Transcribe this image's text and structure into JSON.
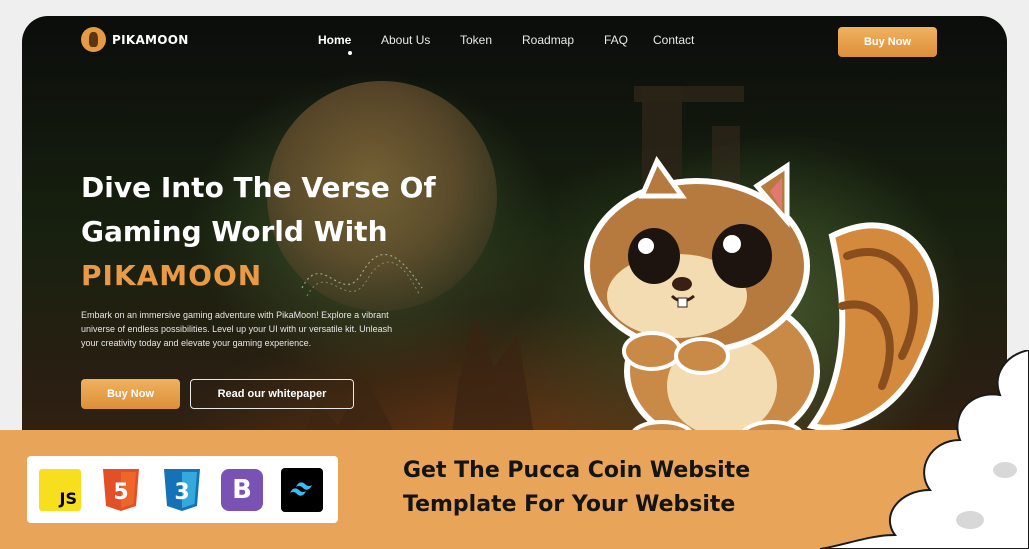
{
  "nav": {
    "logo_text": "PIKAMOON",
    "items": [
      {
        "label": "Home",
        "active": true
      },
      {
        "label": "About Us"
      },
      {
        "label": "Token"
      },
      {
        "label": "Roadmap"
      },
      {
        "label": "FAQ"
      },
      {
        "label": "Contact"
      }
    ],
    "buy_label": "Buy Now"
  },
  "hero": {
    "line1": "Dive Into The Verse Of",
    "line2": "Gaming World With",
    "accent": "PIKAMOON",
    "description": "Embark on an immersive gaming adventure with PikaMoon! Explore a vibrant universe of endless possibilities. Level up your UI with ur versatile kit. Unleash your creativity today and elevate your gaming experience.",
    "primary_label": "Buy Now",
    "secondary_label": "Read our whitepaper"
  },
  "banner": {
    "technologies": [
      {
        "name": "JS",
        "icon": "javascript-icon",
        "color": "#f7df1e"
      },
      {
        "name": "5",
        "icon": "html5-icon",
        "color": "#e34f26"
      },
      {
        "name": "3",
        "icon": "css3-icon",
        "color": "#1572b6"
      },
      {
        "name": "B",
        "icon": "bootstrap-icon",
        "color": "#7952b3"
      },
      {
        "name": "",
        "icon": "tailwind-icon",
        "color": "#000000"
      }
    ],
    "headline_line1": "Get The Pucca Coin Website",
    "headline_line2": "Template For Your Website"
  },
  "colors": {
    "accent": "#e89a45",
    "banner": "#e8a458",
    "hero_bg": "#17200f"
  }
}
